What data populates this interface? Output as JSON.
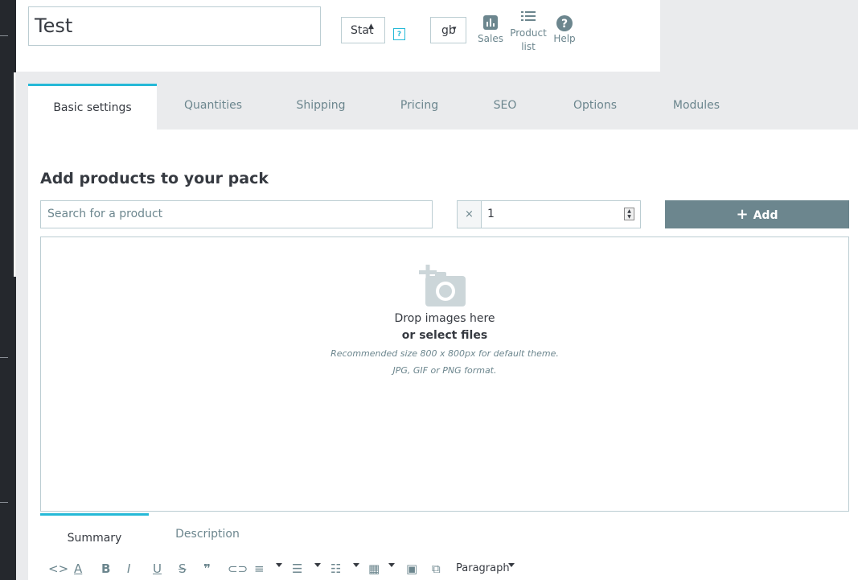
{
  "header": {
    "product_name": "Test",
    "status_select_value": "Static",
    "status_select_display": "Stat",
    "help_marker": "?",
    "language_select_value": "gb",
    "buttons": [
      {
        "label": "Sales",
        "icon": "bar-chart-icon"
      },
      {
        "label": "Product\nlist",
        "line1": "Product",
        "line2": "list",
        "icon": "list-icon"
      },
      {
        "label": "Help",
        "icon": "help-circle-icon"
      }
    ]
  },
  "tabs": [
    {
      "label": "Basic settings",
      "active": true
    },
    {
      "label": "Quantities"
    },
    {
      "label": "Shipping"
    },
    {
      "label": "Pricing"
    },
    {
      "label": "SEO"
    },
    {
      "label": "Options"
    },
    {
      "label": "Modules"
    }
  ],
  "pack": {
    "title": "Add products to your pack",
    "search_placeholder": "Search for a product",
    "quantity_prefix": "×",
    "quantity_value": "1",
    "add_label": "Add",
    "add_icon": "plus-icon"
  },
  "dropzone": {
    "line1": "Drop images here",
    "line2": "or select files",
    "hint1": "Recommended size 800 x 800px for default theme.",
    "hint2": "JPG, GIF or PNG format.",
    "icon": "add-photo-icon"
  },
  "description_tabs": [
    {
      "label": "Summary",
      "active": true
    },
    {
      "label": "Description"
    }
  ],
  "editor_toolbar": {
    "format_select": "Paragraph",
    "tools": [
      "code-icon",
      "text-color-icon",
      "bold-icon",
      "italic-icon",
      "underline-icon",
      "strikethrough-icon",
      "blockquote-icon",
      "link-icon",
      "align-icon",
      "bullet-list-icon",
      "numbered-list-icon",
      "table-icon",
      "image-icon",
      "media-icon"
    ]
  },
  "colors": {
    "accent": "#25b9d7",
    "button_grey": "#6c868e",
    "border": "#bbcdd2",
    "sidebar": "#25282d"
  }
}
